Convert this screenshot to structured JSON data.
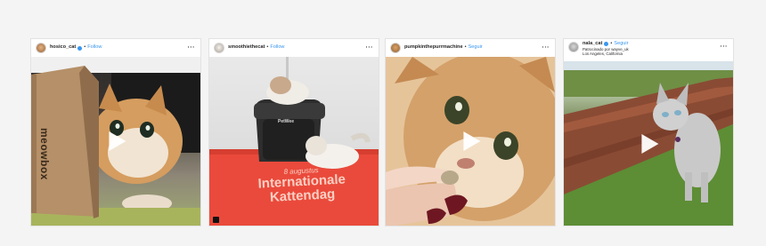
{
  "posts": [
    {
      "username": "hosico_cat",
      "verified": true,
      "follow_label": "Follow",
      "more_icon": "more-horizontal-icon",
      "media_type": "video",
      "box_text": "meowbox"
    },
    {
      "username": "smoothiethecat",
      "verified": false,
      "follow_label": "Follow",
      "more_icon": "more-horizontal-icon",
      "media_type": "photo",
      "litter_box_brand": "PetWee",
      "mat_text_small": "8 augustus",
      "mat_text_line1": "Internationale",
      "mat_text_line2": "Kattendag"
    },
    {
      "username": "pumpkinthepurrmachine",
      "verified": false,
      "follow_label": "Seguir",
      "more_icon": "more-horizontal-icon",
      "media_type": "video"
    },
    {
      "username": "nala_cat",
      "verified": true,
      "follow_label": "Seguir",
      "sponsor_line": "Patrocinado por wayve_uk",
      "location": "Los Angeles, California",
      "more_icon": "more-horizontal-icon",
      "media_type": "video"
    }
  ],
  "colors": {
    "page_bg": "#f4f4f4",
    "follow_blue": "#3897f0",
    "text": "#262626",
    "mat_red": "#ea4a3b"
  }
}
